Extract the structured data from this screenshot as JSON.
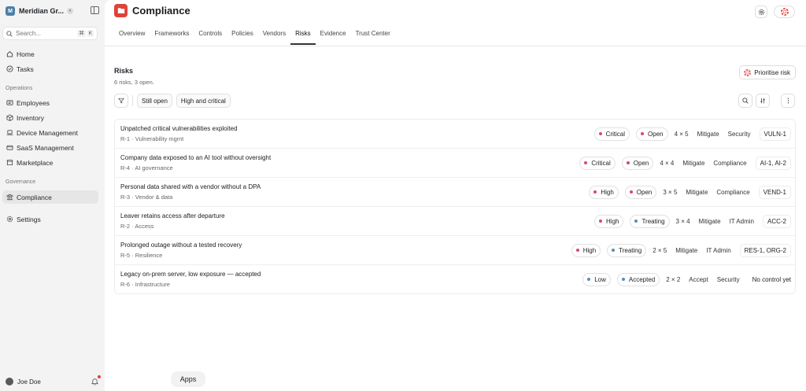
{
  "sidebar": {
    "org": {
      "initial": "M",
      "name": "Meridian Gr..."
    },
    "search": {
      "placeholder": "Search...",
      "shortcut_keys": [
        "⌘",
        "K"
      ]
    },
    "top_items": [
      {
        "label": "Home",
        "icon": "home-icon"
      },
      {
        "label": "Tasks",
        "icon": "check-circle-icon"
      }
    ],
    "sections": [
      {
        "title": "Operations",
        "items": [
          {
            "label": "Employees",
            "icon": "id-card-icon"
          },
          {
            "label": "Inventory",
            "icon": "box-icon"
          },
          {
            "label": "Device Management",
            "icon": "laptop-icon"
          },
          {
            "label": "SaaS Management",
            "icon": "cloud-icon"
          },
          {
            "label": "Marketplace",
            "icon": "store-icon"
          }
        ]
      },
      {
        "title": "Governance",
        "items": [
          {
            "label": "Compliance",
            "icon": "building-columns-icon",
            "active": true
          }
        ]
      }
    ],
    "settings_label": "Settings",
    "user": {
      "name": "Joe Doe",
      "notification_dot": true
    }
  },
  "header": {
    "title": "Compliance",
    "tabs": [
      "Overview",
      "Frameworks",
      "Controls",
      "Policies",
      "Vendors",
      "Risks",
      "Evidence",
      "Trust Center"
    ],
    "active_tab": "Risks"
  },
  "risks_section": {
    "title": "Risks",
    "subtitle": "6 risks, 3 open.",
    "primary_action": "Prioritise risk",
    "filters": [
      "Still open",
      "High and critical"
    ]
  },
  "risks": [
    {
      "title": "Unpatched critical vulnerabilities exploited",
      "meta": "R-1 · Vulnerability mgmt",
      "severity": "Critical",
      "status": "Open",
      "score": "4 × 5",
      "treatment": "Mitigate",
      "owner": "Security",
      "controls": "VULN-1"
    },
    {
      "title": "Company data exposed to an AI tool without oversight",
      "meta": "R-4 · AI governance",
      "severity": "Critical",
      "status": "Open",
      "score": "4 × 4",
      "treatment": "Mitigate",
      "owner": "Compliance",
      "controls": "AI-1, AI-2"
    },
    {
      "title": "Personal data shared with a vendor without a DPA",
      "meta": "R-3 · Vendor & data",
      "severity": "High",
      "status": "Open",
      "score": "3 × 5",
      "treatment": "Mitigate",
      "owner": "Compliance",
      "controls": "VEND-1"
    },
    {
      "title": "Leaver retains access after departure",
      "meta": "R-2 · Access",
      "severity": "High",
      "status": "Treating",
      "score": "3 × 4",
      "treatment": "Mitigate",
      "owner": "IT Admin",
      "controls": "ACC-2"
    },
    {
      "title": "Prolonged outage without a tested recovery",
      "meta": "R-5 · Resilience",
      "severity": "High",
      "status": "Treating",
      "score": "2 × 5",
      "treatment": "Mitigate",
      "owner": "IT Admin",
      "controls": "RES-1, ORG-2"
    },
    {
      "title": "Legacy on-prem server, low exposure — accepted",
      "meta": "R-6 · Infrastructure",
      "severity": "Low",
      "status": "Accepted",
      "score": "2 × 2",
      "treatment": "Accept",
      "owner": "Security",
      "controls": "No control yet"
    }
  ],
  "colors": {
    "accent": "#e0413b",
    "severity": {
      "Critical": "#d94873",
      "High": "#d94873",
      "Low": "#5b8db3"
    },
    "status": {
      "Open": "#d94873",
      "Treating": "#5b8db3",
      "Accepted": "#5b8db3"
    }
  },
  "dock": {
    "apps_label": "Apps"
  }
}
